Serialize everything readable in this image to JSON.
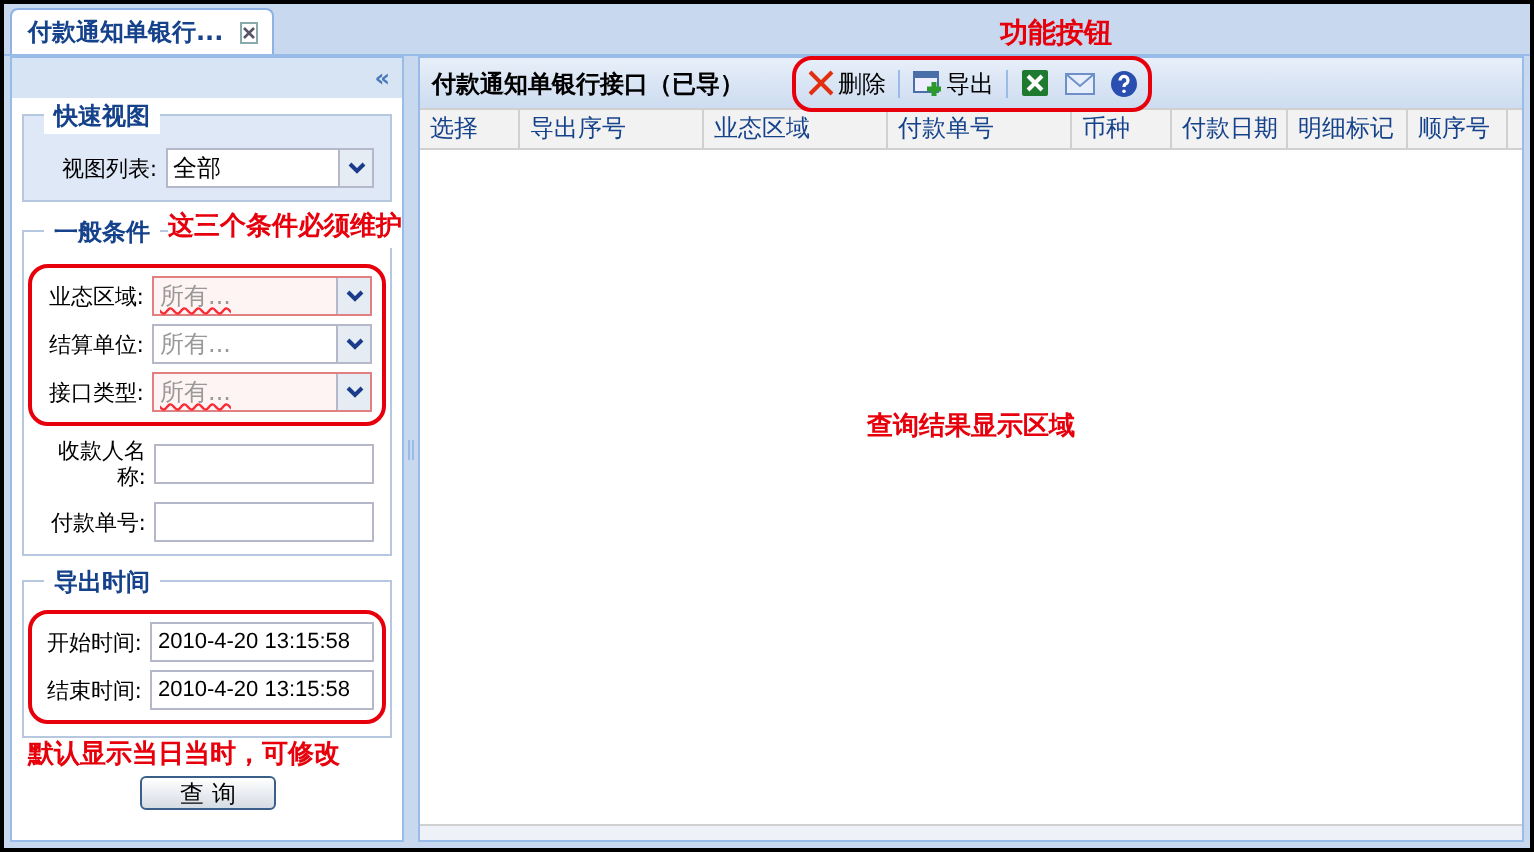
{
  "tabs": [
    {
      "label": "付款通知单银行...",
      "selected": true
    }
  ],
  "left_panel": {
    "collapse": "«",
    "quick_view": {
      "legend": "快速视图",
      "label": "视图列表:",
      "value": "全部"
    },
    "general": {
      "legend": "一般条件",
      "annotation": "这三个条件必须维护",
      "combos": [
        {
          "label": "业态区域:",
          "placeholder": "所有...",
          "invalid": true
        },
        {
          "label": "结算单位:",
          "placeholder": "所有...",
          "invalid": false
        },
        {
          "label": "接口类型:",
          "placeholder": "所有...",
          "invalid": true
        }
      ],
      "inputs": [
        {
          "label": "收款人名称:"
        },
        {
          "label": "付款单号:"
        }
      ]
    },
    "export_time": {
      "legend": "导出时间",
      "fields": [
        {
          "label": "开始时间:",
          "value": "2010-4-20 13:15:58"
        },
        {
          "label": "结束时间:",
          "value": "2010-4-20 13:15:58"
        }
      ],
      "annotation": "默认显示当日当时，可修改"
    },
    "query_button": "查 询"
  },
  "grid": {
    "title": "付款通知单银行接口（已导）",
    "toolbar_annotation": "功能按钮",
    "toolbar": [
      {
        "kind": "delete",
        "label": "删除"
      },
      {
        "kind": "export",
        "label": "导出"
      },
      {
        "kind": "excel"
      },
      {
        "kind": "mail"
      },
      {
        "kind": "help"
      }
    ],
    "columns": [
      "选择",
      "导出序号",
      "业态区域",
      "付款单号",
      "币种",
      "付款日期",
      "明细标记",
      "顺序号"
    ],
    "body_annotation": "查询结果显示区域"
  }
}
